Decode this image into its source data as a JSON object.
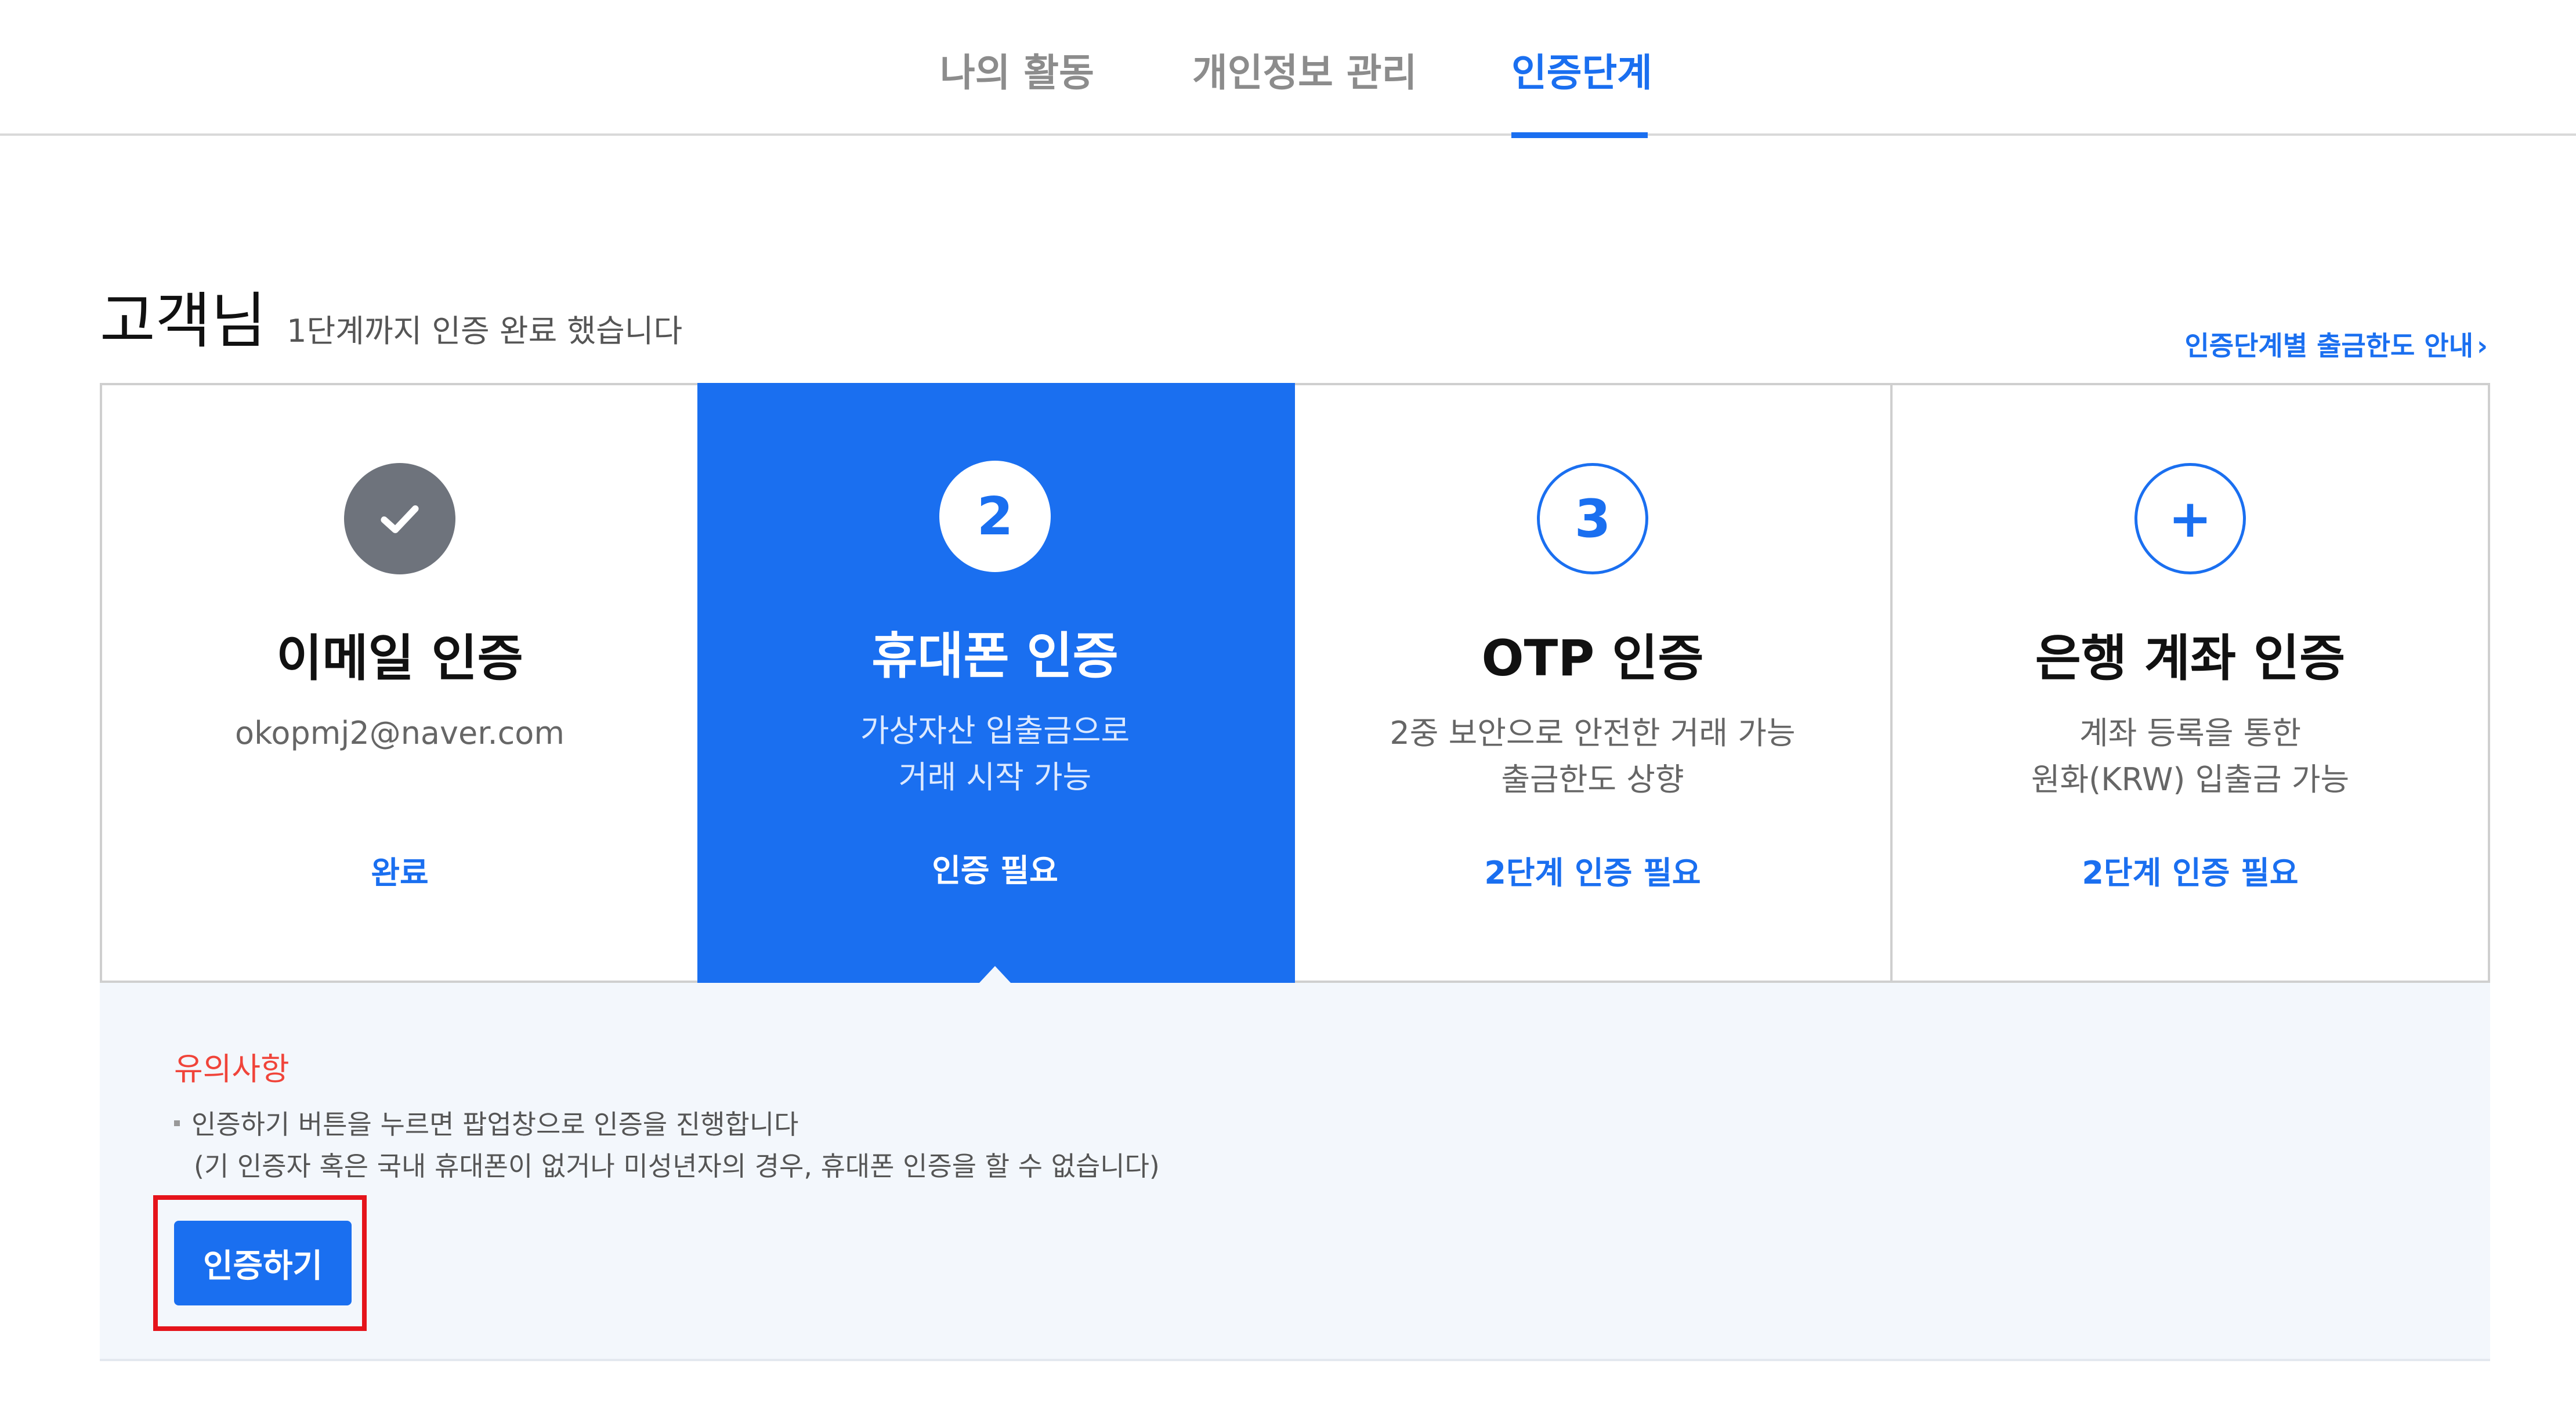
{
  "tabs": [
    {
      "label": "나의 활동"
    },
    {
      "label": "개인정보 관리"
    },
    {
      "label": "인증단계",
      "active": true
    }
  ],
  "greeting": {
    "name": "고객님",
    "subtitle": "1단계까지 인증 완료 했습니다",
    "limit_link": "인증단계별 출금한도 안내",
    "limit_link_chevron": "›"
  },
  "steps": [
    {
      "marker": "check-icon",
      "title": "이메일 인증",
      "desc1": "okopmj2@naver.com",
      "desc2": "",
      "status": "완료",
      "state": "done"
    },
    {
      "marker": "2",
      "title": "휴대폰 인증",
      "desc1": "가상자산 입출금으로",
      "desc2": "거래 시작 가능",
      "status": "인증 필요",
      "state": "current"
    },
    {
      "marker": "3",
      "title": "OTP 인증",
      "desc1": "2중 보안으로 안전한 거래 가능",
      "desc2": "출금한도 상향",
      "status": "2단계 인증 필요",
      "state": "pending"
    },
    {
      "marker": "+",
      "title": "은행 계좌 인증",
      "desc1": "계좌 등록을 통한",
      "desc2": "원화(KRW) 입출금 가능",
      "status": "2단계 인증 필요",
      "state": "pending"
    }
  ],
  "notice": {
    "title": "유의사항",
    "line1": "인증하기 버튼을 누르면 팝업창으로 인증을 진행합니다",
    "line2": "(기 인증자 혹은 국내 휴대폰이 없거나 미성년자의 경우, 휴대폰 인증을 할 수 없습니다)",
    "button_label": "인증하기"
  },
  "colors": {
    "accent": "#1a6ff0",
    "done_gray": "#6e737c",
    "warning_red": "#f0443a",
    "highlight_red": "#e5141b",
    "panel_bg": "#f3f7fc"
  }
}
